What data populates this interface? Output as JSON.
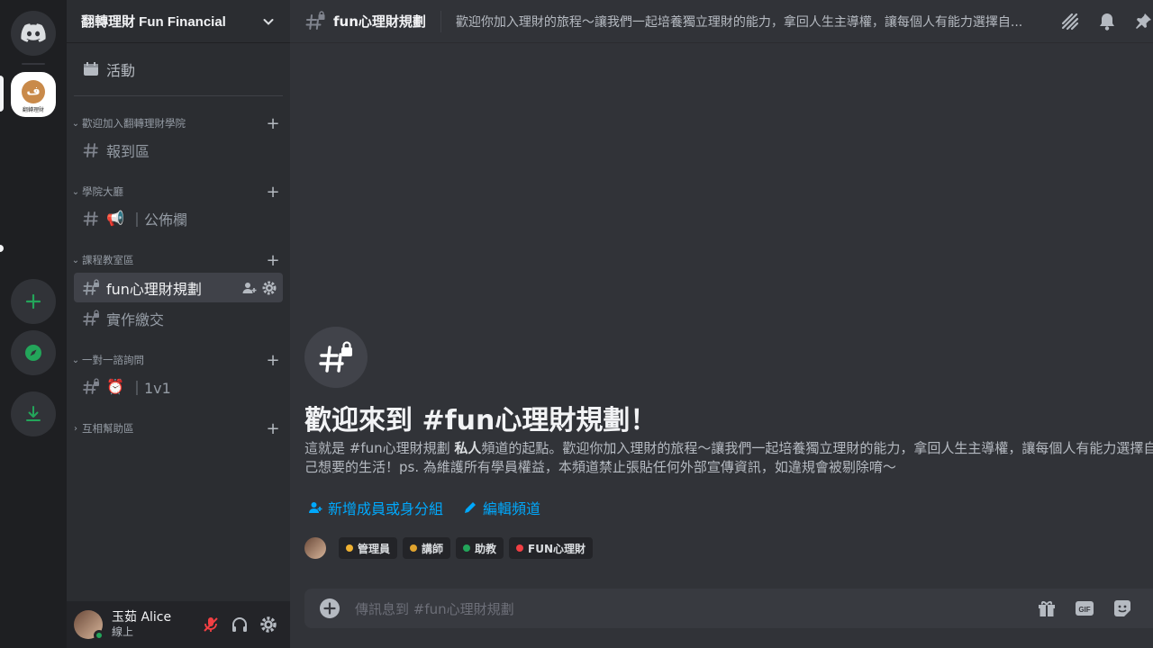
{
  "server": {
    "name": "翻轉理財 Fun Financial",
    "icon_text": "翻轉理財"
  },
  "sidebar": {
    "activity_label": "活動",
    "categories": [
      {
        "label": "歡迎加入翻轉理財學院",
        "channels": [
          {
            "label": "報到區"
          }
        ]
      },
      {
        "label": "學院大廳",
        "channels": [
          {
            "emoji": "📢",
            "label": "｜公佈欄"
          }
        ]
      },
      {
        "label": "課程教室區",
        "channels": [
          {
            "label": "fun心理財規劃"
          },
          {
            "label": "實作繳交"
          }
        ]
      },
      {
        "label": "一對一諮詢問",
        "channels": [
          {
            "emoji": "⏰",
            "label": "｜1v1"
          }
        ]
      },
      {
        "label": "互相幫助區",
        "channels": []
      }
    ]
  },
  "user": {
    "name": "玉茹 Alice",
    "status": "線上"
  },
  "channel": {
    "name": "fun心理財規劃",
    "topic": "歡迎你加入理財的旅程～讓我們一起培養獨立理財的能力，拿回人生主導權，讓每個人有能力選擇自..."
  },
  "welcome": {
    "title": "歡迎來到 #fun心理財規劃！",
    "desc_prefix": "這就是 #fun心理財規劃 ",
    "desc_bold": "私人",
    "desc_suffix": "頻道的起點。歡迎你加入理財的旅程～讓我們一起培養獨立理財的能力，拿回人生主導權，讓每個人有能力選擇自己想要的生活！ps. 為維護所有學員權益，本頻道禁止張貼任何外部宣傳資訊，如違規會被剔除唷～",
    "add_members": "新增成員或身分組",
    "edit_channel": "編輯頻道"
  },
  "roles": [
    {
      "label": "管理員",
      "color": "#f0b232"
    },
    {
      "label": "講師",
      "color": "#e0a32e"
    },
    {
      "label": "助教",
      "color": "#23a55a"
    },
    {
      "label": "FUN心理財",
      "color": "#f23f43"
    }
  ],
  "composer": {
    "placeholder": "傳訊息到 #fun心理財規劃"
  },
  "colors": {
    "accent": "#00a8fc",
    "green": "#23a55a",
    "rail_bg": "#1e1f22",
    "sidebar_bg": "#2b2d31",
    "main_bg": "#313338"
  }
}
